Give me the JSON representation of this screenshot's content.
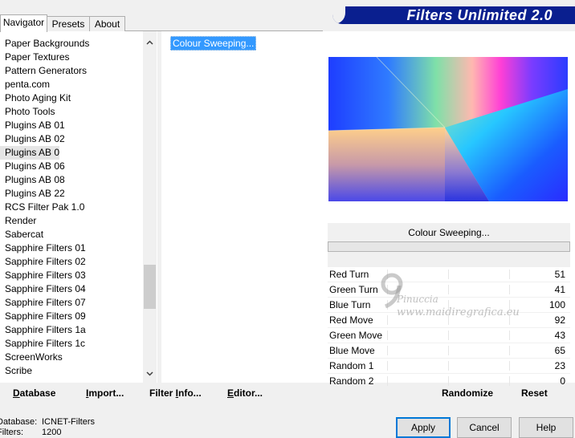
{
  "header": {
    "title": "Filters Unlimited 2.0"
  },
  "tabs": [
    {
      "label": "Navigator",
      "active": true
    },
    {
      "label": "Presets",
      "active": false
    },
    {
      "label": "About",
      "active": false
    }
  ],
  "categories": {
    "items": [
      "Paper Backgrounds",
      "Paper Textures",
      "Pattern Generators",
      "penta.com",
      "Photo Aging Kit",
      "Photo Tools",
      "Plugins AB 01",
      "Plugins AB 02",
      "Plugins AB 04",
      "Plugins AB 06",
      "Plugins AB 08",
      "Plugins AB 22",
      "RCS Filter Pak 1.0",
      "Render",
      "Sabercat",
      "Sapphire Filters 01",
      "Sapphire Filters 02",
      "Sapphire Filters 03",
      "Sapphire Filters 04",
      "Sapphire Filters 07",
      "Sapphire Filters 09",
      "Sapphire Filters 1a",
      "Sapphire Filters 1c",
      "ScreenWorks",
      "Scribe"
    ],
    "selected": "Plugins AB 04"
  },
  "filters": {
    "items": [
      "Colour Sweeping..."
    ],
    "selected": "Colour Sweeping..."
  },
  "filter_panel": {
    "name": "Colour Sweeping...",
    "params": [
      {
        "label": "Red Turn",
        "value": "51"
      },
      {
        "label": "Green Turn",
        "value": "41"
      },
      {
        "label": "Blue Turn",
        "value": "100"
      },
      {
        "label": "Red Move",
        "value": "92"
      },
      {
        "label": "Green Move",
        "value": "43"
      },
      {
        "label": "Blue Move",
        "value": "65"
      },
      {
        "label": "Random 1",
        "value": "23"
      },
      {
        "label": "Random 2",
        "value": "0"
      }
    ]
  },
  "watermark": {
    "line1": "Pinuccia",
    "line2": "www.maidiregrafica.eu"
  },
  "buttons": {
    "database": {
      "ul": "D",
      "rest": "atabase"
    },
    "import": {
      "ul": "I",
      "rest": "mport..."
    },
    "filter_info": {
      "pre": "Filter ",
      "ul": "I",
      "rest": "nfo..."
    },
    "editor": {
      "ul": "E",
      "rest": "ditor..."
    },
    "randomize": "Randomize",
    "reset": "Reset",
    "apply": "Apply",
    "cancel": "Cancel",
    "help": "Help"
  },
  "database_info": {
    "db_label": "Database:",
    "db_value": "ICNET-Filters",
    "filters_label": "Filters:",
    "filters_value": "1200"
  },
  "icons": {
    "scroll_up": "chevron-up-icon",
    "scroll_down": "chevron-down-icon"
  }
}
